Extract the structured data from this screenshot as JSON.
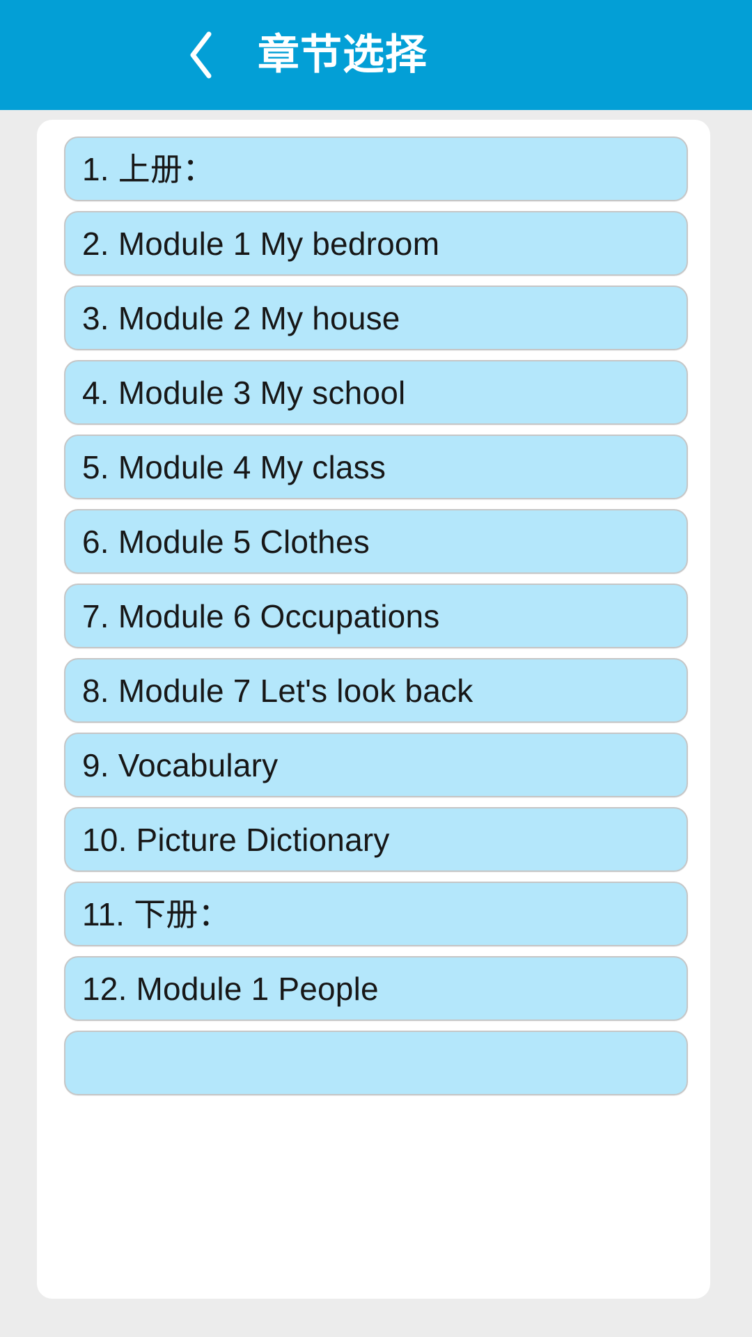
{
  "header": {
    "title": "章节选择",
    "back_icon": "chevron-left-icon",
    "background_color": "#039fd6",
    "title_color": "#ffffff"
  },
  "theme": {
    "page_background": "#ececec",
    "card_background": "#ffffff",
    "item_fill": "#b4e7fb",
    "item_border": "#c6c6c6",
    "item_text": "#171717"
  },
  "chapter_list": {
    "items": [
      {
        "label": "1. 上册："
      },
      {
        "label": "2. Module 1 My bedroom"
      },
      {
        "label": "3. Module 2 My house"
      },
      {
        "label": "4. Module 3 My school"
      },
      {
        "label": "5. Module 4 My class"
      },
      {
        "label": "6. Module 5 Clothes"
      },
      {
        "label": "7. Module 6 Occupations"
      },
      {
        "label": "8. Module 7 Let's look back"
      },
      {
        "label": "9. Vocabulary"
      },
      {
        "label": "10. Picture Dictionary"
      },
      {
        "label": "11. 下册："
      },
      {
        "label": "12. Module 1 People"
      },
      {
        "label": ""
      }
    ]
  }
}
